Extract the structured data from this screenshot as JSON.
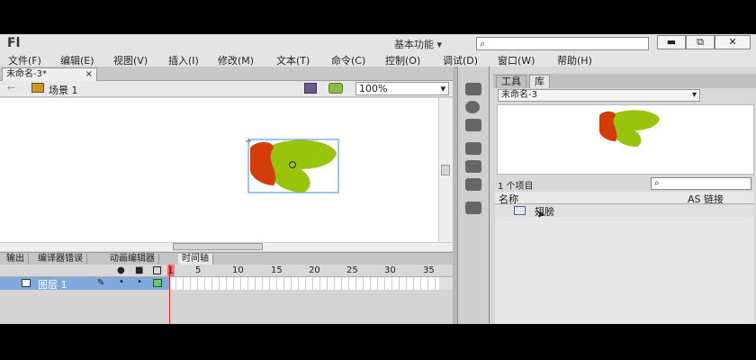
{
  "app": {
    "logo": "Fl",
    "workspace": "基本功能",
    "workspace_arrow": "▾"
  },
  "icons": {
    "search": "⌕",
    "minimize": "▬",
    "restore": "⧉",
    "close": "✕",
    "back": "←",
    "scene": "scene-icon",
    "dropdown": "▾"
  },
  "menu": [
    "文件(F)",
    "编辑(E)",
    "视图(V)",
    "插入(I)",
    "修改(M)",
    "文本(T)",
    "命令(C)",
    "控制(O)",
    "调试(D)",
    "窗口(W)",
    "帮助(H)"
  ],
  "document": {
    "tab_label": "未命名-3*",
    "tab_close": "×",
    "scene_label": "场景 1",
    "zoom": "100%"
  },
  "panel_tabs": [
    "输出",
    "编译器错误",
    "动画编辑器",
    "时间轴"
  ],
  "timeline": {
    "frame_numbers": [
      "1",
      "5",
      "10",
      "15",
      "20",
      "25",
      "30",
      "35"
    ],
    "layer_name": "图层 1"
  },
  "library": {
    "tabs": [
      "工具",
      "库"
    ],
    "document_name": "未命名-3",
    "item_count": "1 个项目",
    "col_name": "名称",
    "col_linkage": "AS 链接",
    "items": [
      {
        "name": "翅膀"
      }
    ]
  },
  "colors": {
    "shape_red": "#d43c0c",
    "shape_green": "#98c40c",
    "selection": "#3b8ee8",
    "layer_bg": "#7fa9de",
    "playhead": "#e02020"
  }
}
